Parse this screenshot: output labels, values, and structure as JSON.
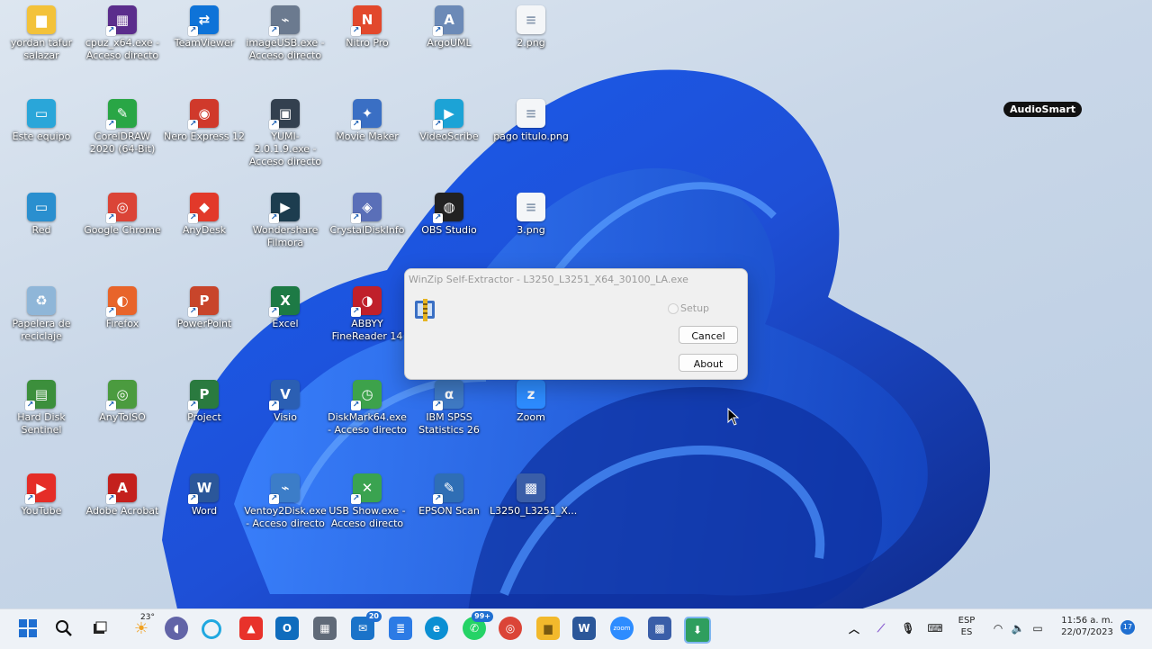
{
  "desktop": {
    "icons": [
      {
        "label": "yordan tafur salazar",
        "icon": "folder-icon",
        "color": "#f3c23a",
        "glyph": "▆",
        "shortcut": false
      },
      {
        "label": "cpuz_x64.exe - Acceso directo",
        "icon": "cpuz-icon",
        "color": "#5b2d8c",
        "glyph": "▦",
        "shortcut": true
      },
      {
        "label": "TeamViewer",
        "icon": "teamviewer-icon",
        "color": "#0e73d8",
        "glyph": "⇄",
        "shortcut": true
      },
      {
        "label": "imageUSB.exe - Acceso directo",
        "icon": "imageusb-icon",
        "color": "#6b7a8f",
        "glyph": "⌁",
        "shortcut": true
      },
      {
        "label": "Nitro Pro",
        "icon": "nitro-icon",
        "color": "#e2482c",
        "glyph": "N",
        "shortcut": true
      },
      {
        "label": "ArgoUML",
        "icon": "argouml-icon",
        "color": "#6c8ab7",
        "glyph": "A",
        "shortcut": true
      },
      {
        "label": "2.png",
        "icon": "image-file-icon",
        "color": "#f4f6f8",
        "glyph": "≡",
        "shortcut": false
      },
      {
        "label": "Este equipo",
        "icon": "computer-icon",
        "color": "#2aa6d9",
        "glyph": "▭",
        "shortcut": false
      },
      {
        "label": "CorelDRAW 2020 (64-Bit)",
        "icon": "coreldraw-icon",
        "color": "#29a645",
        "glyph": "✎",
        "shortcut": true
      },
      {
        "label": "Nero Express 12",
        "icon": "nero-icon",
        "color": "#d0392b",
        "glyph": "◉",
        "shortcut": true
      },
      {
        "label": "YUMI-2.0.1.9.exe - Acceso directo",
        "icon": "yumi-icon",
        "color": "#33404f",
        "glyph": "▣",
        "shortcut": true
      },
      {
        "label": "Movie Maker",
        "icon": "moviemaker-icon",
        "color": "#3a6fc4",
        "glyph": "✦",
        "shortcut": true
      },
      {
        "label": "VideoScribe",
        "icon": "videoscribe-icon",
        "color": "#1ca3d6",
        "glyph": "▶",
        "shortcut": true
      },
      {
        "label": "pago titulo.png",
        "icon": "image-file-icon",
        "color": "#f4f6f8",
        "glyph": "≡",
        "shortcut": false
      },
      {
        "label": "Red",
        "icon": "network-icon",
        "color": "#2a8fcf",
        "glyph": "▭",
        "shortcut": false
      },
      {
        "label": "Google Chrome",
        "icon": "chrome-icon",
        "color": "#db4437",
        "glyph": "◎",
        "shortcut": true
      },
      {
        "label": "AnyDesk",
        "icon": "anydesk-icon",
        "color": "#e2392a",
        "glyph": "◆",
        "shortcut": true
      },
      {
        "label": "Wondershare Filmora",
        "icon": "filmora-icon",
        "color": "#1d3d4f",
        "glyph": "▶",
        "shortcut": true
      },
      {
        "label": "CrystalDiskInfo",
        "icon": "crystaldisk-icon",
        "color": "#5a6fb8",
        "glyph": "◈",
        "shortcut": true
      },
      {
        "label": "OBS Studio",
        "icon": "obs-icon",
        "color": "#222222",
        "glyph": "◍",
        "shortcut": true
      },
      {
        "label": "3.png",
        "icon": "image-file-icon",
        "color": "#f4f6f8",
        "glyph": "≡",
        "shortcut": false
      },
      {
        "label": "Papelera de reciclaje",
        "icon": "recycle-bin-icon",
        "color": "#8fb6d8",
        "glyph": "♻",
        "shortcut": false
      },
      {
        "label": "Firefox",
        "icon": "firefox-icon",
        "color": "#e8642a",
        "glyph": "◐",
        "shortcut": true
      },
      {
        "label": "PowerPoint",
        "icon": "powerpoint-icon",
        "color": "#c8452b",
        "glyph": "P",
        "shortcut": true
      },
      {
        "label": "Excel",
        "icon": "excel-icon",
        "color": "#1d7a45",
        "glyph": "X",
        "shortcut": true
      },
      {
        "label": "ABBYY FineReader 14",
        "icon": "abbyy-icon",
        "color": "#c0202a",
        "glyph": "◑",
        "shortcut": true
      },
      {
        "label": "Hard Disk Sentinel",
        "icon": "hdsentinel-icon",
        "color": "#3c8f3c",
        "glyph": "▤",
        "shortcut": true
      },
      {
        "label": "AnyToISO",
        "icon": "anytoiso-icon",
        "color": "#4b9b3f",
        "glyph": "◎",
        "shortcut": true
      },
      {
        "label": "Project",
        "icon": "project-icon",
        "color": "#2a7a3f",
        "glyph": "P",
        "shortcut": true
      },
      {
        "label": "Visio",
        "icon": "visio-icon",
        "color": "#2b5fb3",
        "glyph": "V",
        "shortcut": true
      },
      {
        "label": "DiskMark64.exe - Acceso directo",
        "icon": "diskmark-icon",
        "color": "#3da24b",
        "glyph": "◷",
        "shortcut": true
      },
      {
        "label": "IBM SPSS Statistics 26",
        "icon": "spss-icon",
        "color": "#3f7ac4",
        "glyph": "α",
        "shortcut": true
      },
      {
        "label": "Zoom",
        "icon": "zoom-icon",
        "color": "#2d8cff",
        "glyph": "z",
        "shortcut": false
      },
      {
        "label": "YouTube",
        "icon": "youtube-icon",
        "color": "#e52d27",
        "glyph": "▶",
        "shortcut": true
      },
      {
        "label": "Adobe Acrobat",
        "icon": "acrobat-icon",
        "color": "#c4201d",
        "glyph": "A",
        "shortcut": true
      },
      {
        "label": "Word",
        "icon": "word-icon",
        "color": "#2b579a",
        "glyph": "W",
        "shortcut": true
      },
      {
        "label": "Ventoy2Disk.exe - Acceso directo",
        "icon": "ventoy-icon",
        "color": "#3c7dc8",
        "glyph": "⌁",
        "shortcut": true
      },
      {
        "label": "USB Show.exe - Acceso directo",
        "icon": "usbshow-icon",
        "color": "#3aa350",
        "glyph": "✕",
        "shortcut": true
      },
      {
        "label": "EPSON Scan",
        "icon": "epson-scan-icon",
        "color": "#2f6eb5",
        "glyph": "✎",
        "shortcut": true
      },
      {
        "label": "L3250_L3251_X...",
        "icon": "winzip-exe-icon",
        "color": "#3a5ea8",
        "glyph": "▩",
        "shortcut": false
      }
    ]
  },
  "audiosmart": {
    "label": "AudioSmart"
  },
  "dialog": {
    "title": "WinZip Self-Extractor - L3250_L3251_X64_30100_LA.exe",
    "setup_label": "Setup",
    "cancel_label": "Cancel",
    "about_label": "About"
  },
  "taskbar": {
    "weather_temp": "23°",
    "mail_badge": "20",
    "whatsapp_badge": "99+",
    "zoom_label": "zoom",
    "lang_top": "ESP",
    "lang_bottom": "ES",
    "time": "11:56 a. m.",
    "date": "22/07/2023",
    "notifications": "17"
  }
}
